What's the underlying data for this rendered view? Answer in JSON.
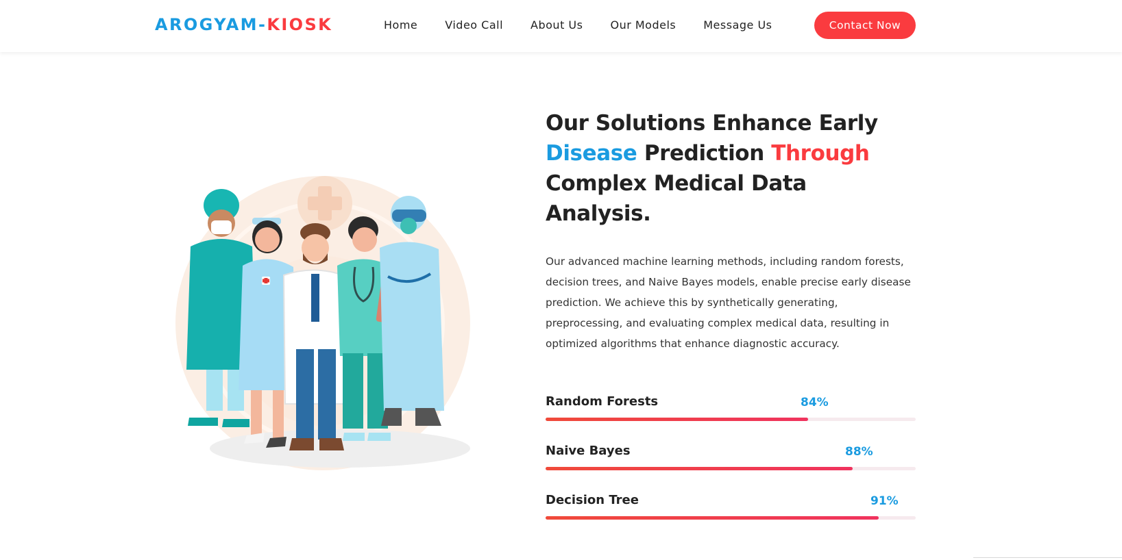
{
  "brand": {
    "part1": "AROGYAM-",
    "part2": "KIOSK"
  },
  "nav": {
    "items": [
      "Home",
      "Video Call",
      "About Us",
      "Our Models",
      "Message Us"
    ],
    "cta": "Contact Now"
  },
  "hero": {
    "heading": {
      "line1": "Our Solutions Enhance Early",
      "blue_word": "Disease",
      "middle": " Prediction ",
      "red_word": "Through",
      "line3": "Complex Medical Data",
      "line4": "Analysis."
    },
    "description": "Our advanced machine learning methods, including random forests, decision trees, and Naive Bayes models, enable precise early disease prediction. We achieve this by synthetically generating, preprocessing, and evaluating complex medical data, resulting in optimized algorithms that enhance diagnostic accuracy.",
    "illustration_icon": "medical-team-illustration"
  },
  "skills": [
    {
      "name": "Random Forests",
      "percent_label": "84%",
      "value": 71
    },
    {
      "name": "Naive Bayes",
      "percent_label": "88%",
      "value": 83
    },
    {
      "name": "Decision Tree",
      "percent_label": "91%",
      "value": 90
    }
  ],
  "colors": {
    "blue": "#1a9be0",
    "red": "#fa3b3f",
    "bar_start": "#f04a3a",
    "bar_end": "#f0335e",
    "track": "#f6eaee"
  }
}
